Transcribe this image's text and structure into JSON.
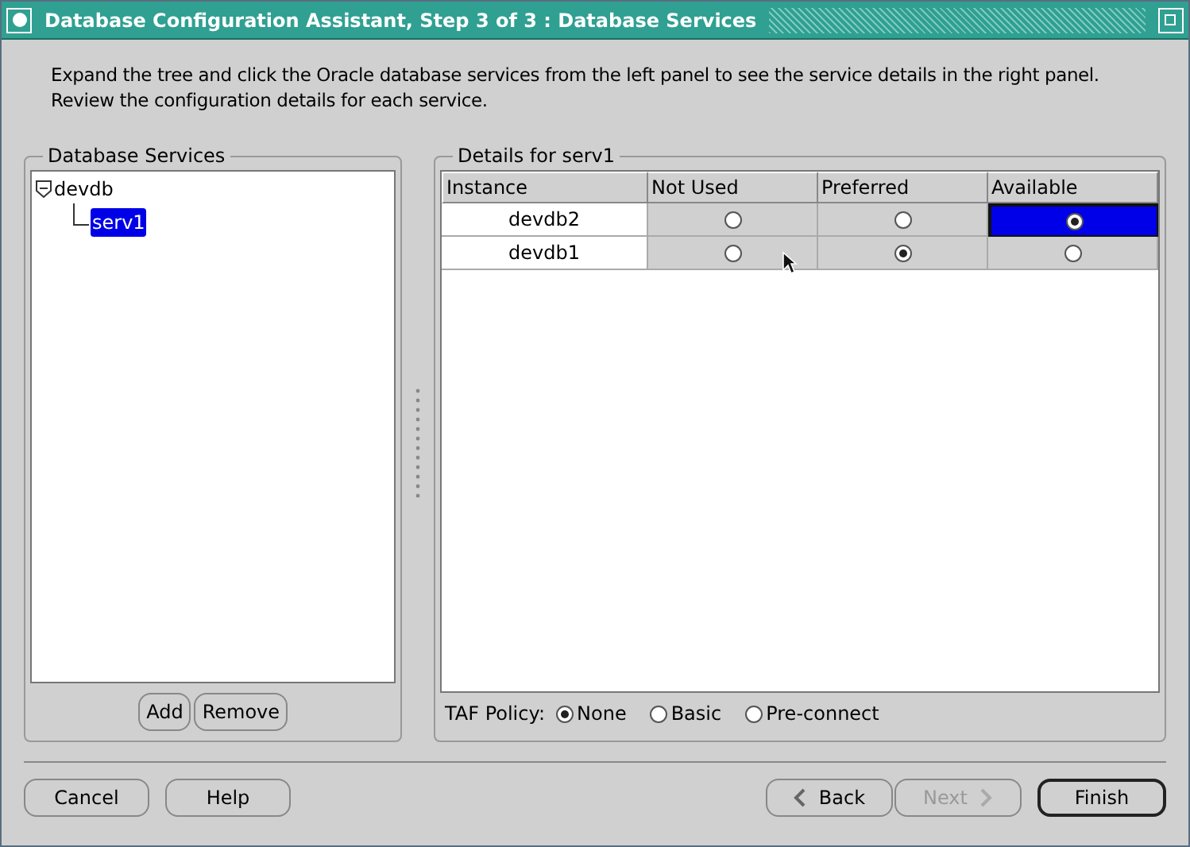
{
  "window": {
    "title": "Database Configuration Assistant, Step 3 of 3 : Database Services"
  },
  "instructions": "Expand the tree and click the Oracle database services from the left panel to see the service details in the right panel. Review the configuration details for each service.",
  "services_panel": {
    "title": "Database Services",
    "tree": [
      {
        "label": "devdb",
        "expanded": true,
        "selected": false,
        "children": [
          {
            "label": "serv1",
            "selected": true
          }
        ]
      }
    ],
    "buttons": [
      "Add",
      "Remove"
    ]
  },
  "details_panel": {
    "title": "Details for serv1",
    "columns": [
      "Instance",
      "Not Used",
      "Preferred",
      "Available"
    ],
    "rows": [
      {
        "instance": "devdb2",
        "options": [
          {
            "selected": false,
            "focused": false
          },
          {
            "selected": false,
            "focused": false
          },
          {
            "selected": true,
            "focused": true
          }
        ]
      },
      {
        "instance": "devdb1",
        "options": [
          {
            "selected": false,
            "focused": false
          },
          {
            "selected": true,
            "focused": false
          },
          {
            "selected": false,
            "focused": false
          }
        ]
      }
    ],
    "taf_label": "TAF Policy:",
    "taf_options": [
      {
        "label": "None",
        "selected": true
      },
      {
        "label": "Basic",
        "selected": false
      },
      {
        "label": "Pre-connect",
        "selected": false
      }
    ]
  },
  "footer": {
    "left_buttons": [
      {
        "label": "Cancel",
        "disabled": false,
        "default": false
      },
      {
        "label": "Help",
        "disabled": false,
        "default": false
      }
    ],
    "nav_buttons": [
      {
        "label": "Back",
        "kind": "back",
        "disabled": false
      },
      {
        "label": "Next",
        "kind": "next",
        "disabled": true
      }
    ],
    "finish": {
      "label": "Finish",
      "default": true
    }
  }
}
